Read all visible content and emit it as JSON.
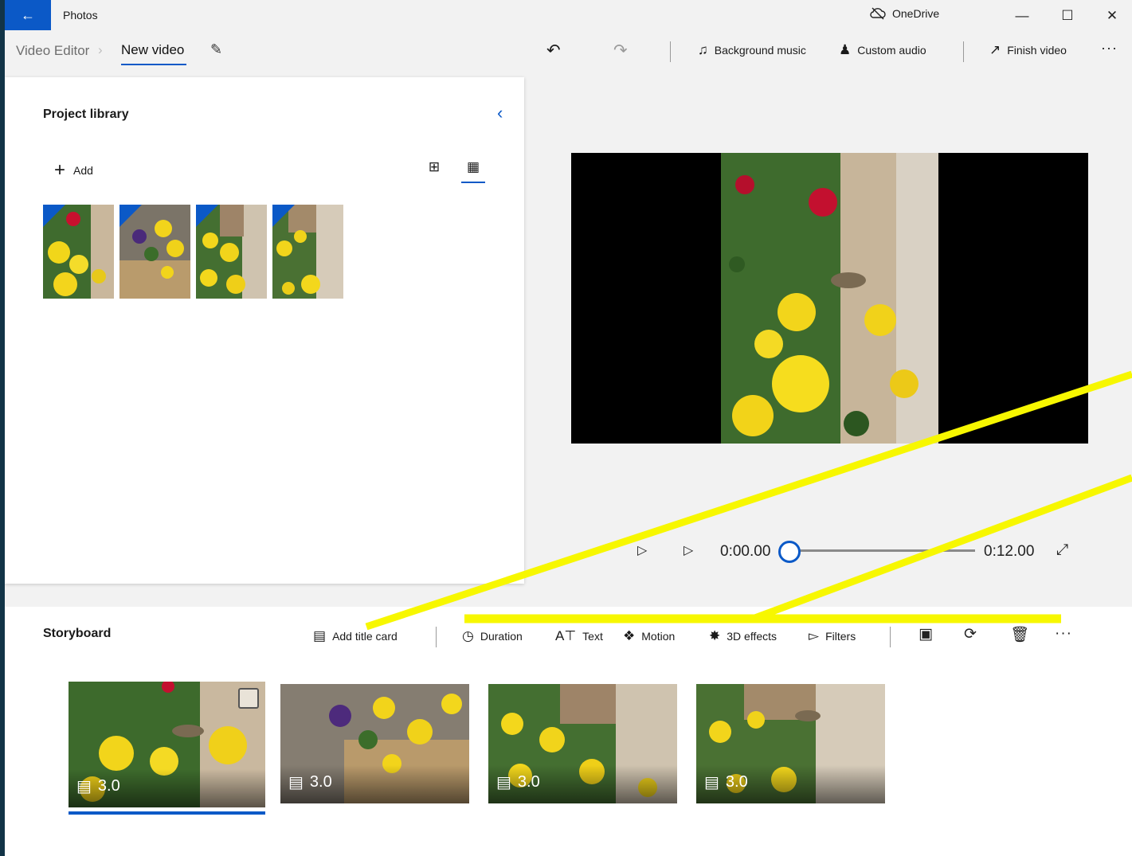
{
  "window": {
    "app_title": "Photos",
    "onedrive_label": "OneDrive",
    "back_icon": "arrow-left-icon"
  },
  "breadcrumb": {
    "root": "Video Editor",
    "current": "New video"
  },
  "toolbar": {
    "background_music": "Background music",
    "custom_audio": "Custom audio",
    "finish_video": "Finish video"
  },
  "library": {
    "title": "Project library",
    "add_label": "Add",
    "items": [
      {
        "name": "photo-flowers-red-yellow"
      },
      {
        "name": "photo-flowers-purple-yellow"
      },
      {
        "name": "photo-flowers-yellow-wall"
      },
      {
        "name": "photo-flowers-moth"
      }
    ]
  },
  "playback": {
    "current_time": "0:00.00",
    "total_time": "0:12.00",
    "progress": 0
  },
  "storyboard": {
    "title": "Storyboard",
    "add_title_card": "Add title card",
    "duration": "Duration",
    "text": "Text",
    "motion": "Motion",
    "effects_3d": "3D effects",
    "filters": "Filters",
    "clips": [
      {
        "duration": "3.0",
        "selected": true
      },
      {
        "duration": "3.0",
        "selected": false
      },
      {
        "duration": "3.0",
        "selected": false
      },
      {
        "duration": "3.0",
        "selected": false
      }
    ]
  },
  "colors": {
    "accent": "#0b59c7",
    "annotation": "#f7f700"
  }
}
